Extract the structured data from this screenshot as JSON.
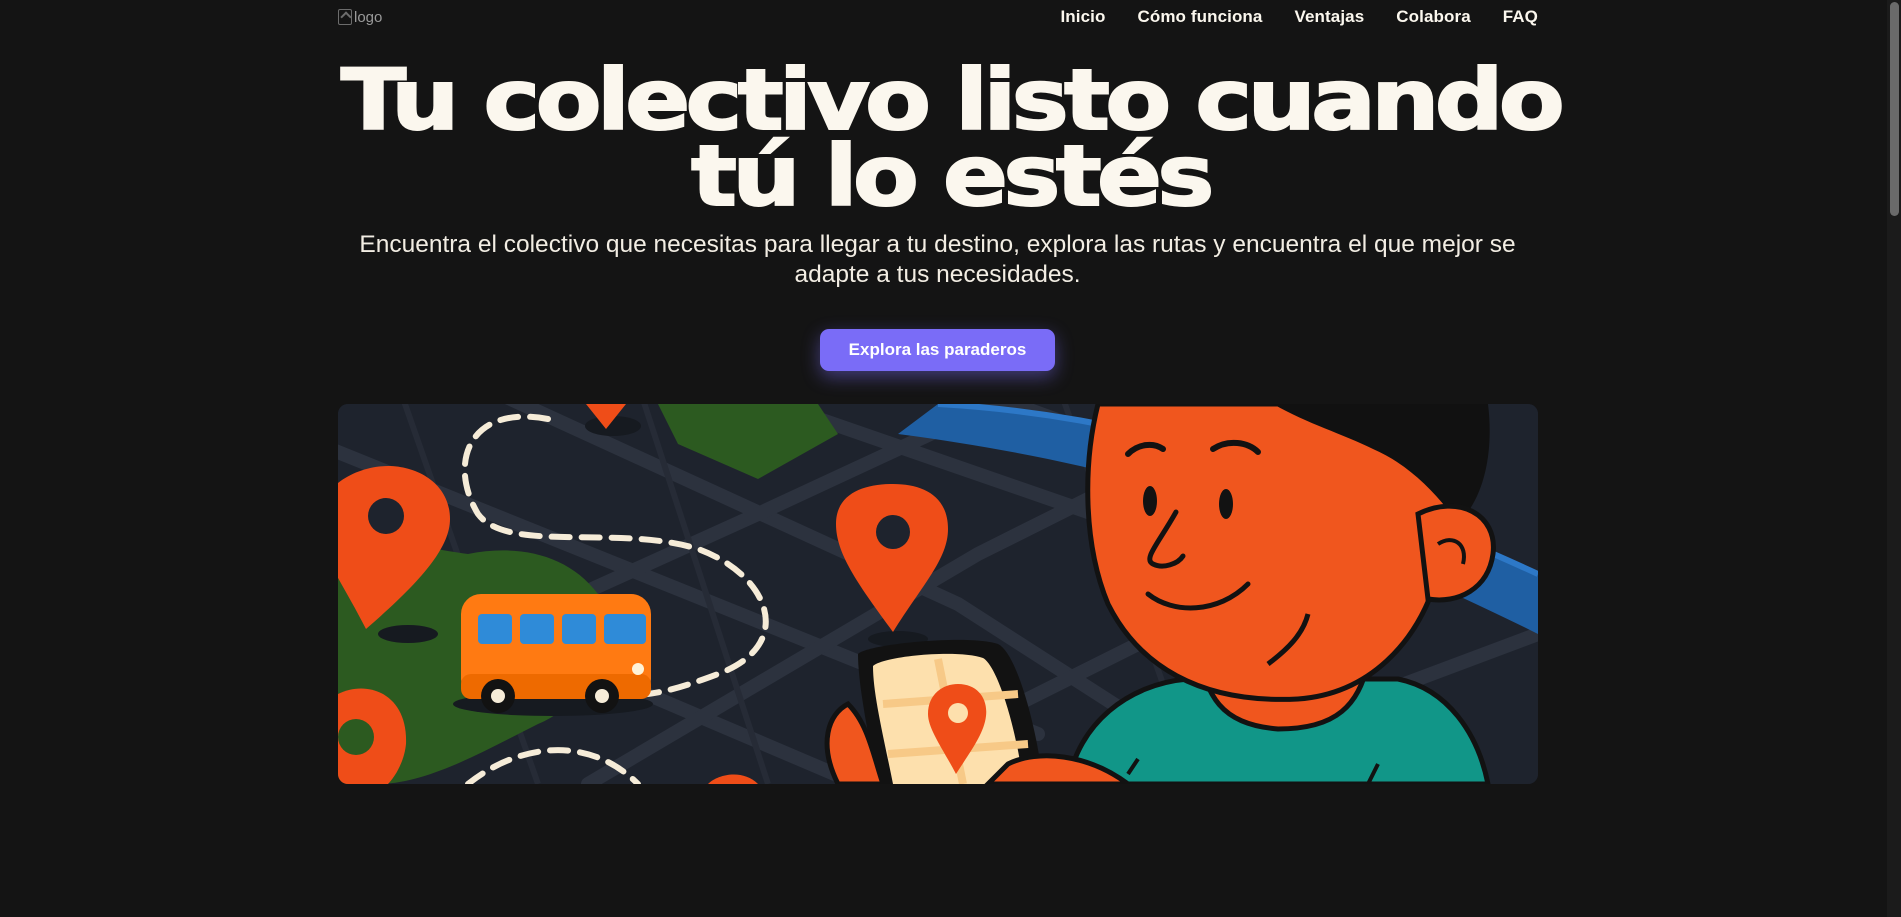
{
  "header": {
    "logo_alt": "logo",
    "nav": [
      {
        "label": "Inicio"
      },
      {
        "label": "Cómo funciona"
      },
      {
        "label": "Ventajas"
      },
      {
        "label": "Colabora"
      },
      {
        "label": "FAQ"
      }
    ]
  },
  "hero": {
    "title_line1": "Tu colectivo listo cuando",
    "title_line2": "tú lo estés",
    "subtitle": "Encuentra el colectivo que necesitas para llegar a tu destino, explora las rutas y encuentra el que mejor se adapte a tus necesidades.",
    "cta_label": "Explora las paraderos"
  },
  "theme": {
    "background": "#141414",
    "text": "#fbf7ee",
    "accent": "#7a6cf7",
    "illustration_orange": "#f0561e"
  },
  "illustration": {
    "icons": [
      "map-pin-icon",
      "bus-icon",
      "phone-icon",
      "person-icon"
    ]
  }
}
